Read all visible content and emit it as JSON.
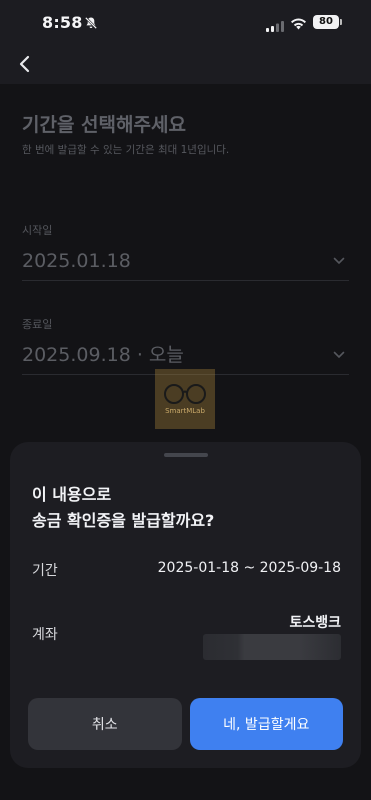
{
  "status_bar": {
    "time": "8:58",
    "battery": "80"
  },
  "page": {
    "title": "기간을 선택해주세요",
    "subtitle": "한 번에 발급할 수 있는 기간은 최대 1년입니다.",
    "start_label": "시작일",
    "start_value": "2025.01.18",
    "end_label": "종료일",
    "end_value": "2025.09.18 · 오늘"
  },
  "watermark": {
    "text": "SmartMLab"
  },
  "sheet": {
    "title_line1": "이 내용으로",
    "title_line2": "송금 확인증을 발급할까요?",
    "period_label": "기간",
    "period_value": "2025-01-18 ~ 2025-09-18",
    "account_label": "계좌",
    "bank_name": "토스뱅크",
    "cancel_label": "취소",
    "confirm_label": "네, 발급할게요"
  },
  "colors": {
    "accent": "#3f80f0",
    "sheet_bg": "#1d1d22"
  },
  "icons": [
    "bell-slash-icon",
    "signal-icon",
    "wifi-icon",
    "battery-icon",
    "back-arrow-icon",
    "chevron-down-icon"
  ]
}
